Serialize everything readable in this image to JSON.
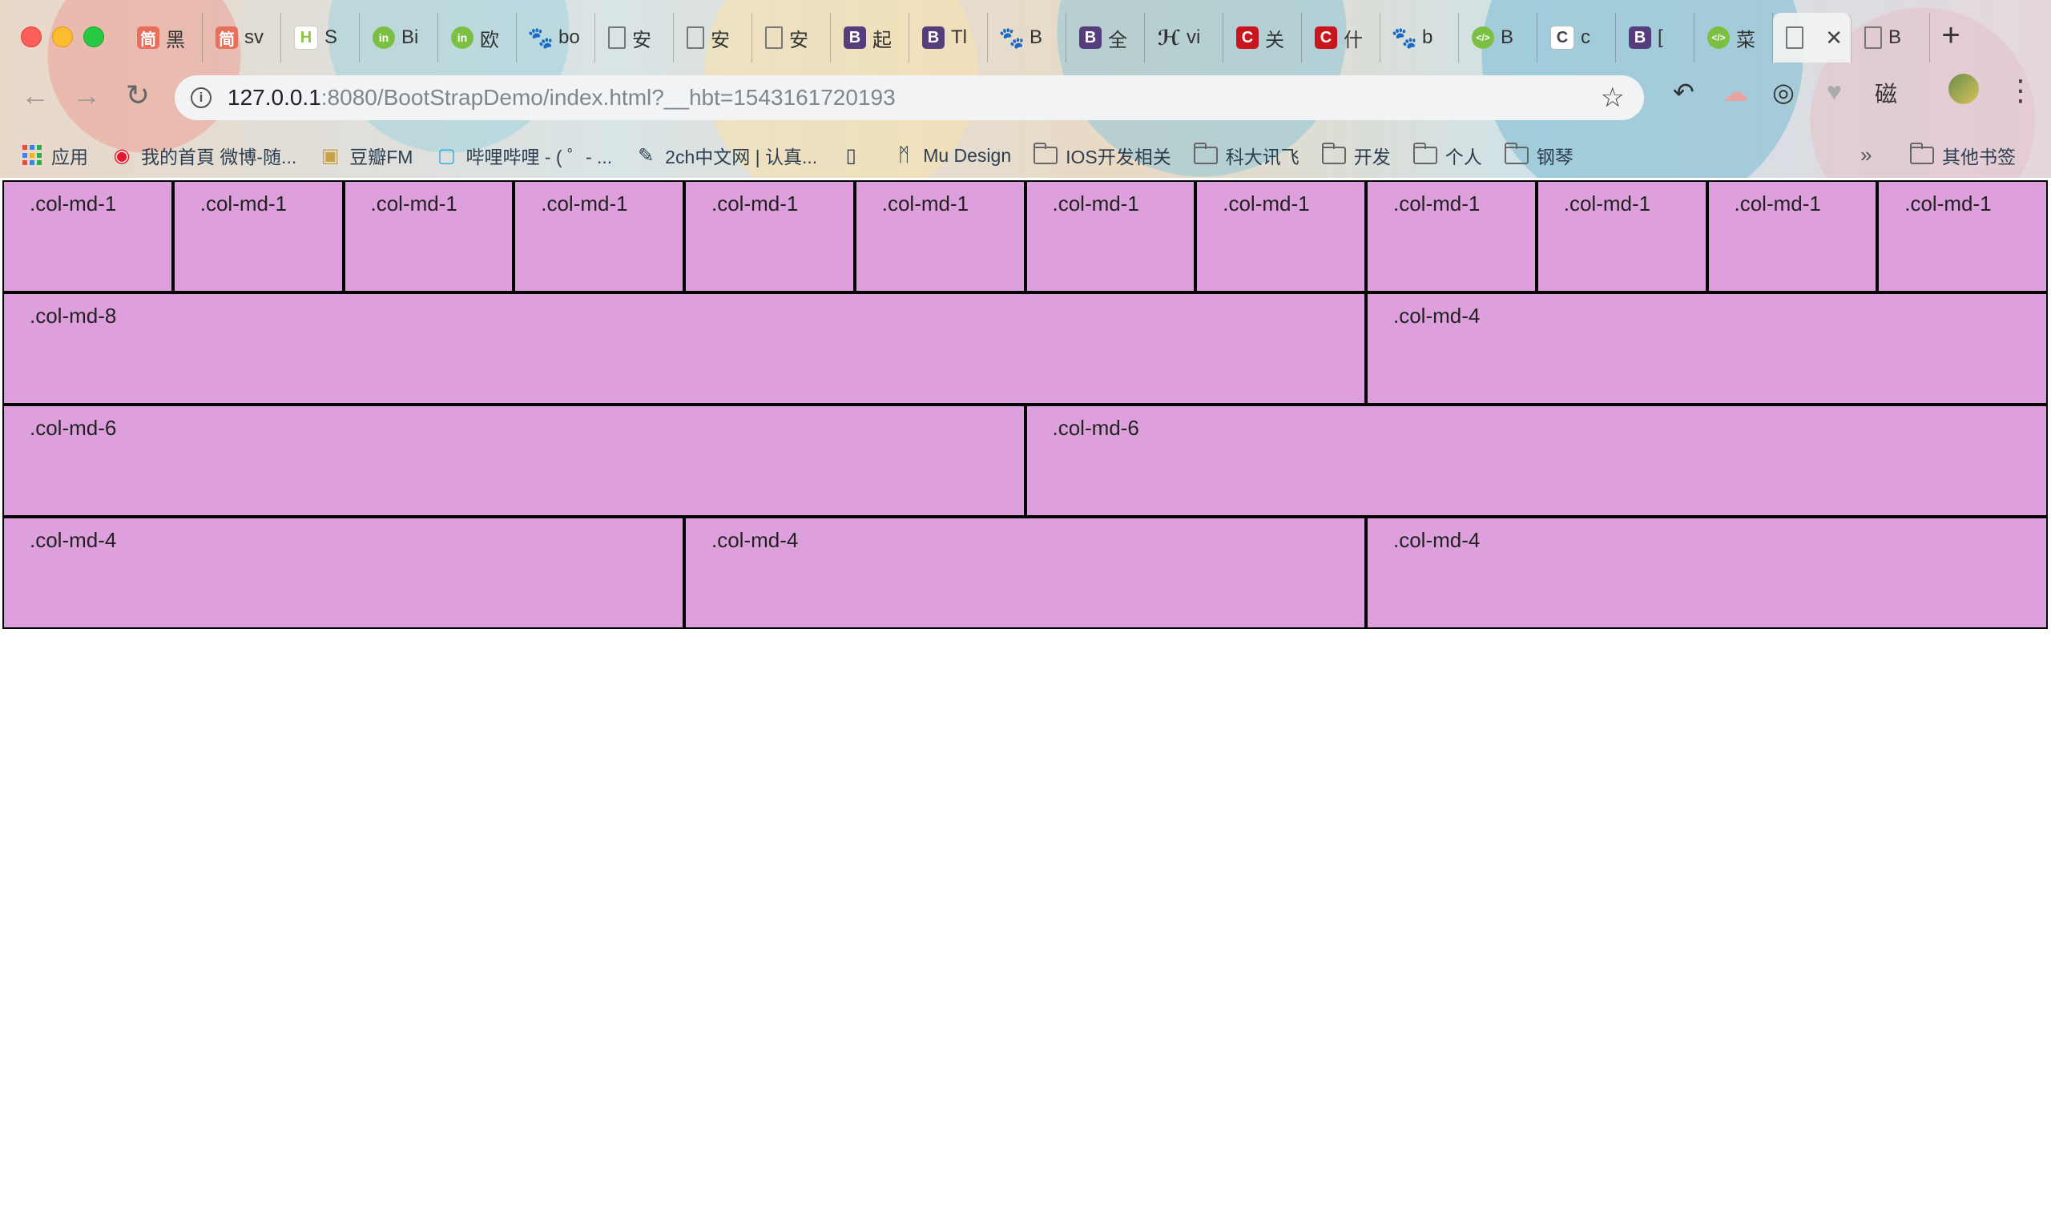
{
  "window": {
    "traffic_lights": [
      "close",
      "minimize",
      "zoom"
    ]
  },
  "tabs": [
    {
      "icon": "jianshu-icon",
      "glyph": "简",
      "label": "黑"
    },
    {
      "icon": "jianshu-icon",
      "glyph": "简",
      "label": "sv"
    },
    {
      "icon": "h-icon",
      "glyph": "H",
      "label": "S"
    },
    {
      "icon": "in-icon",
      "glyph": "in",
      "label": "Bi"
    },
    {
      "icon": "in-icon",
      "glyph": "in",
      "label": "欧"
    },
    {
      "icon": "baidu-paw-icon",
      "glyph": "🐾",
      "label": "bo"
    },
    {
      "icon": "document-icon",
      "glyph": "",
      "label": "安"
    },
    {
      "icon": "document-icon",
      "glyph": "",
      "label": "安"
    },
    {
      "icon": "document-icon",
      "glyph": "",
      "label": "安"
    },
    {
      "icon": "bootstrap-icon",
      "glyph": "B",
      "label": "起"
    },
    {
      "icon": "bootstrap-icon",
      "glyph": "B",
      "label": "Tl"
    },
    {
      "icon": "baidu-paw-icon",
      "glyph": "🐾",
      "label": "B"
    },
    {
      "icon": "bootstrap-icon",
      "glyph": "B",
      "label": "全"
    },
    {
      "icon": "vue-logo-icon",
      "glyph": "ℋ",
      "label": "vi"
    },
    {
      "icon": "csdn-icon",
      "glyph": "C",
      "label": "关"
    },
    {
      "icon": "csdn-icon",
      "glyph": "C",
      "label": "什"
    },
    {
      "icon": "baidu-paw-icon",
      "glyph": "🐾",
      "label": "b"
    },
    {
      "icon": "code-icon",
      "glyph": "</>",
      "label": "B"
    },
    {
      "icon": "c-white-icon",
      "glyph": "C",
      "label": "c"
    },
    {
      "icon": "bootstrap-icon",
      "glyph": "B",
      "label": "["
    },
    {
      "icon": "code-icon",
      "glyph": "</>",
      "label": "菜"
    },
    {
      "icon": "document-icon",
      "glyph": "",
      "label": "",
      "active": true,
      "close": "✕"
    },
    {
      "icon": "document-icon",
      "glyph": "",
      "label": "B"
    }
  ],
  "new_tab_label": "+",
  "toolbar": {
    "back": "←",
    "forward": "→",
    "reload": "↻",
    "info": "i",
    "url_host": "127.0.0.1",
    "url_rest": ":8080/BootStrapDemo/index.html?__hbt=1543161720193",
    "star": "☆",
    "extensions": [
      "↶",
      "☁",
      "◎",
      "♥",
      "磁"
    ],
    "menu": "⋮"
  },
  "bookmarks": [
    {
      "icon": "apps-grid-icon",
      "label": "应用"
    },
    {
      "icon": "weibo-icon",
      "label": "我的首頁 微博-随..."
    },
    {
      "icon": "douban-fm-icon",
      "label": "豆瓣FM"
    },
    {
      "icon": "bilibili-icon",
      "label": "哔哩哔哩 - ( ゜- ..."
    },
    {
      "icon": "2ch-icon",
      "label": "2ch中文网 | 认真..."
    },
    {
      "icon": "document-icon",
      "label": ""
    },
    {
      "icon": "mu-design-icon",
      "label": "Mu Design"
    },
    {
      "icon": "folder-icon",
      "label": "IOS开发相关"
    },
    {
      "icon": "folder-icon",
      "label": "科大讯飞"
    },
    {
      "icon": "folder-icon",
      "label": "开发"
    },
    {
      "icon": "folder-icon",
      "label": "个人"
    },
    {
      "icon": "folder-icon",
      "label": "钢琴"
    }
  ],
  "bookmarks_more": "»",
  "other_bookmarks": "其他书签",
  "grid_rows": [
    [
      ".col-md-1",
      ".col-md-1",
      ".col-md-1",
      ".col-md-1",
      ".col-md-1",
      ".col-md-1",
      ".col-md-1",
      ".col-md-1",
      ".col-md-1",
      ".col-md-1",
      ".col-md-1",
      ".col-md-1"
    ],
    [
      ".col-md-8",
      ".col-md-4"
    ],
    [
      ".col-md-6",
      ".col-md-6"
    ],
    [
      ".col-md-4",
      ".col-md-4",
      ".col-md-4"
    ]
  ],
  "colors": {
    "column_fill": "#dda0dd",
    "column_border": "#000000"
  }
}
